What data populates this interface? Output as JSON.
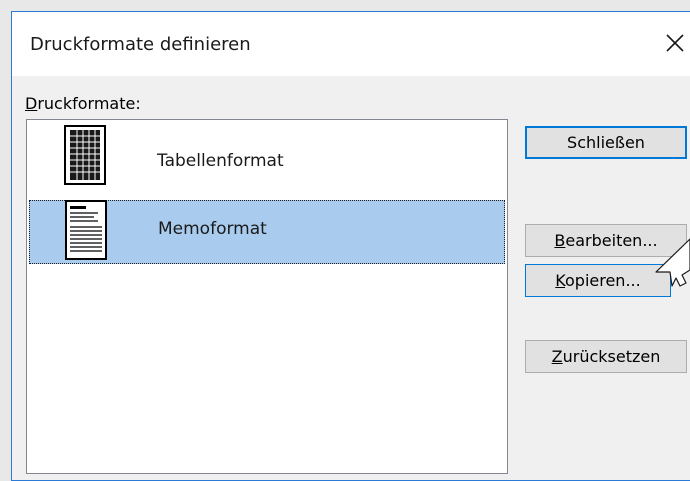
{
  "dialog": {
    "title": "Druckformate definieren",
    "close_icon": "close-icon"
  },
  "list": {
    "label_accel": "D",
    "label_rest": "ruckformate:",
    "items": [
      {
        "label": "Tabellenformat",
        "icon": "table-style-icon",
        "selected": false
      },
      {
        "label": "Memoformat",
        "icon": "memo-style-icon",
        "selected": true
      }
    ]
  },
  "buttons": {
    "close": {
      "label": "Schließen"
    },
    "edit": {
      "accel": "B",
      "rest": "earbeiten..."
    },
    "copy": {
      "accel": "K",
      "rest": "opieren..."
    },
    "reset": {
      "accel": "Z",
      "rest": "urücksetzen"
    }
  },
  "colors": {
    "selection": "#a9ccee",
    "window_border": "#2b7bd6",
    "default_button_border": "#0078d7"
  }
}
